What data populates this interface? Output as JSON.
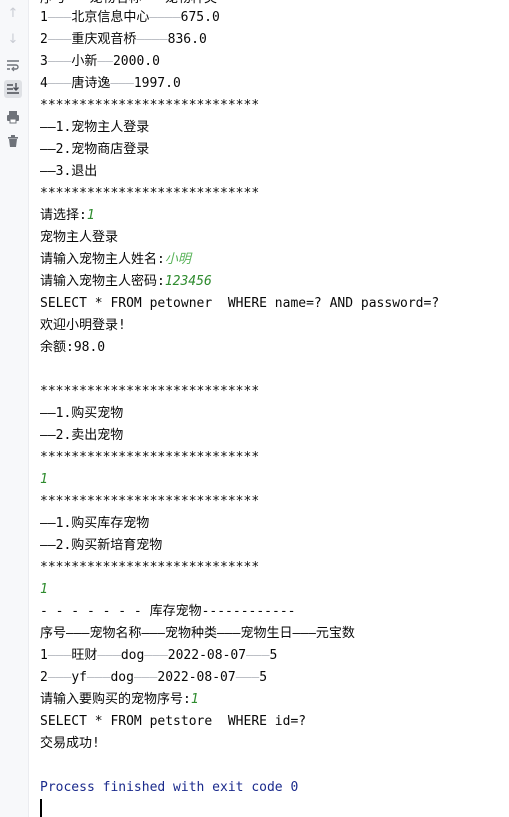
{
  "toolbar": {
    "icons": [
      "arrow-up-icon",
      "arrow-down-icon",
      "soft-wrap-icon",
      "scroll-to-end-icon",
      "print-icon",
      "trash-icon"
    ]
  },
  "console": {
    "header_partial": "序号———宠物名称———宠物种类",
    "stores": [
      {
        "no": "1",
        "sep1": "———",
        "name": "北京信息中心",
        "sep2": "————",
        "value": "675.0"
      },
      {
        "no": "2",
        "sep1": "———",
        "name": "重庆观音桥",
        "sep2": "————",
        "value": "836.0"
      },
      {
        "no": "3",
        "sep1": "———",
        "name": "小新",
        "sep2": "——",
        "value": "2000.0"
      },
      {
        "no": "4",
        "sep1": "———",
        "name": "唐诗逸",
        "sep2": "———",
        "value": "1997.0"
      }
    ],
    "stars": "****************************",
    "menu1": [
      "——1.宠物主人登录",
      "——2.宠物商店登录",
      "——3.退出"
    ],
    "select_prompt": "请选择:",
    "select_value": "1",
    "login_title": "宠物主人登录",
    "name_prompt": "请输入宠物主人姓名:",
    "name_value": "小明",
    "pwd_prompt": "请输入宠物主人密码:",
    "pwd_value": "123456",
    "sql1": "SELECT * FROM petowner  WHERE name=? AND password=?",
    "welcome": "欢迎小明登录!",
    "balance": "余额:98.0",
    "menu2": [
      "——1.购买宠物",
      "——2.卖出宠物"
    ],
    "choice2": "1",
    "menu3": [
      "——1.购买库存宠物",
      "——2.购买新培育宠物"
    ],
    "choice3": "1",
    "stock_header": "- - - - - - - 库存宠物------------",
    "table_header": "序号———宠物名称———宠物种类———宠物生日———元宝数",
    "pets": [
      {
        "no": "1",
        "s1": "———",
        "name": "旺财",
        "s2": "———",
        "type": "dog",
        "s3": "———",
        "birthday": "2022-08-07",
        "s4": "———",
        "coins": "5"
      },
      {
        "no": "2",
        "s1": "———",
        "name": "yf",
        "s2": "———",
        "type": "dog",
        "s3": "———",
        "birthday": "2022-08-07",
        "s4": "———",
        "coins": "5"
      }
    ],
    "buy_prompt": "请输入要购买的宠物序号:",
    "buy_value": "1",
    "sql2": "SELECT * FROM petstore  WHERE id=?",
    "success": "交易成功!",
    "finished": "Process finished with exit code 0"
  }
}
